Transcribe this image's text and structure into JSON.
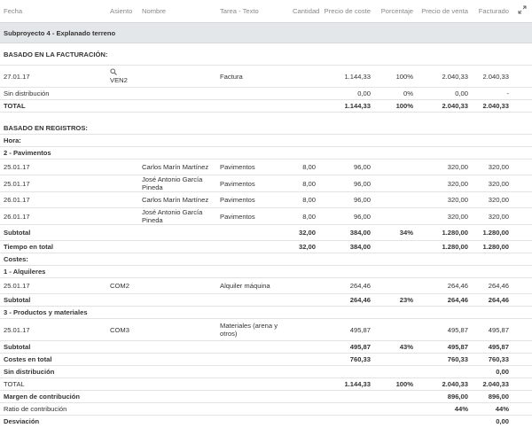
{
  "columns": {
    "fecha": "Fecha",
    "asiento": "Asiento",
    "nombre": "Nombre",
    "tarea": "Tarea - Texto",
    "cantidad": "Cantidad",
    "precio_coste": "Precio de coste",
    "porcentaje": "Porcentaje",
    "precio_venta": "Precio de venta",
    "facturado": "Facturado"
  },
  "icons": {
    "expand": "expand-icon",
    "search": "search-icon"
  },
  "subproject": "Subproyecto 4 - Explanado terreno",
  "facturacion": {
    "title": "BASADO EN LA FACTURACIÓN:",
    "row": {
      "fecha": "27.01.17",
      "asiento": "VEN2",
      "tarea": "Factura",
      "coste": "1.144,33",
      "porc": "100%",
      "venta": "2.040,33",
      "fact": "2.040,33"
    },
    "sin": {
      "label": "Sin distribución",
      "coste": "0,00",
      "porc": "0%",
      "venta": "0,00",
      "fact": "-"
    },
    "total": {
      "label": "TOTAL",
      "coste": "1.144,33",
      "porc": "100%",
      "venta": "2.040,33",
      "fact": "2.040,33"
    }
  },
  "registros": {
    "title": "BASADO EN REGISTROS:",
    "hora": "Hora:",
    "pav_title": "2 - Pavimentos",
    "pav": [
      {
        "fecha": "25.01.17",
        "nombre": "Carlos Marín Martínez",
        "tarea": "Pavimentos",
        "cant": "8,00",
        "coste": "96,00",
        "venta": "320,00",
        "fact": "320,00"
      },
      {
        "fecha": "25.01.17",
        "nombre": "José Antonio García Pineda",
        "tarea": "Pavimentos",
        "cant": "8,00",
        "coste": "96,00",
        "venta": "320,00",
        "fact": "320,00"
      },
      {
        "fecha": "26.01.17",
        "nombre": "Carlos Marín Martínez",
        "tarea": "Pavimentos",
        "cant": "8,00",
        "coste": "96,00",
        "venta": "320,00",
        "fact": "320,00"
      },
      {
        "fecha": "26.01.17",
        "nombre": "José Antonio García Pineda",
        "tarea": "Pavimentos",
        "cant": "8,00",
        "coste": "96,00",
        "venta": "320,00",
        "fact": "320,00"
      }
    ],
    "pav_subtotal": {
      "label": "Subtotal",
      "cant": "32,00",
      "coste": "384,00",
      "porc": "34%",
      "venta": "1.280,00",
      "fact": "1.280,00"
    },
    "tiempo_total": {
      "label": "Tiempo en total",
      "cant": "32,00",
      "coste": "384,00",
      "venta": "1.280,00",
      "fact": "1.280,00"
    },
    "costes": "Costes:",
    "alq_title": "1 - Alquileres",
    "alq": {
      "fecha": "25.01.17",
      "asiento": "COM2",
      "tarea": "Alquiler máquina",
      "coste": "264,46",
      "venta": "264,46",
      "fact": "264,46"
    },
    "alq_subtotal": {
      "label": "Subtotal",
      "coste": "264,46",
      "porc": "23%",
      "venta": "264,46",
      "fact": "264,46"
    },
    "prod_title": "3 - Productos y materiales",
    "prod": {
      "fecha": "25.01.17",
      "asiento": "COM3",
      "tarea": "Materiales (arena y otros)",
      "coste": "495,87",
      "venta": "495,87",
      "fact": "495,87"
    },
    "prod_subtotal": {
      "label": "Subtotal",
      "coste": "495,87",
      "porc": "43%",
      "venta": "495,87",
      "fact": "495,87"
    },
    "costes_total": {
      "label": "Costes en total",
      "coste": "760,33",
      "venta": "760,33",
      "fact": "760,33"
    },
    "sin": {
      "label": "Sin distribución",
      "fact": "0,00"
    },
    "total": {
      "label": "TOTAL",
      "coste": "1.144,33",
      "porc": "100%",
      "venta": "2.040,33",
      "fact": "2.040,33"
    },
    "margen": {
      "label": "Margen de contribución",
      "venta": "896,00",
      "fact": "896,00"
    },
    "ratio": {
      "label": "Ratio de contribución",
      "venta": "44%",
      "fact": "44%"
    },
    "desviacion": {
      "label": "Desviación",
      "fact": "0,00"
    }
  }
}
